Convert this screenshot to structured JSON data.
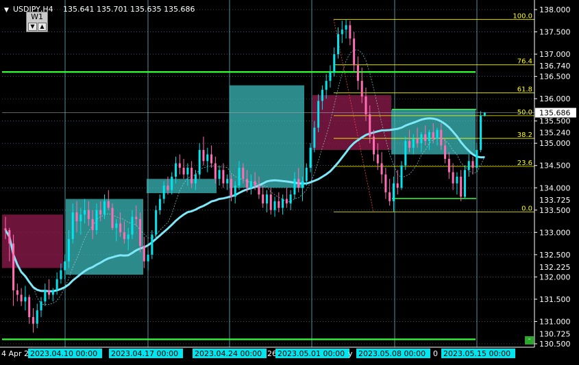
{
  "header": {
    "symbol_label": "USDJPY,H4",
    "ohlc": "135.641 135.701 135.635 135.686",
    "menu_arrow": "▼"
  },
  "timeframe_panel": {
    "label": "W1",
    "down_btn": "▼",
    "up_btn": "▲"
  },
  "colors": {
    "background": "#000000",
    "grid": "#7ad7ea",
    "bull_candle": "#00e5ee",
    "bear_candle": "#ff6eb4",
    "zone_bull": "#3fbfbf",
    "zone_bear": "#8b1a4a",
    "ma_slow": "#7ee8f8",
    "ma_fast": "#9fdfe0",
    "fibo": "#ffff00",
    "hline_green": "#33ff33",
    "axis_text": "#ffffff",
    "date_bg": "#00e5ee"
  },
  "chart_data": {
    "type": "candlestick",
    "symbol": "USDJPY",
    "timeframe": "H4",
    "ylim": [
      130.5,
      138.0
    ],
    "y_ticks": [
      "138.000",
      "137.500",
      "137.000",
      "136.500",
      "136.000",
      "135.500",
      "135.000",
      "134.500",
      "134.000",
      "133.500",
      "133.000",
      "132.500",
      "132.000",
      "131.500",
      "131.000",
      "130.500"
    ],
    "price_labels": [
      {
        "text": "136.740",
        "value": 136.74
      },
      {
        "text": "135.686",
        "value": 135.686,
        "current": true
      },
      {
        "text": "135.240",
        "value": 135.24
      },
      {
        "text": "133.725",
        "value": 133.725
      },
      {
        "text": "132.225",
        "value": 132.225
      },
      {
        "text": "130.725",
        "value": 130.725
      }
    ],
    "x_labels": [
      {
        "text": "4 Apr 2",
        "partial": true
      },
      {
        "text": "2023.04.10 00:00",
        "highlight": true
      },
      {
        "text": "2023.04.17 00:00",
        "highlight": true
      },
      {
        "text": "2023.04.24 00:00",
        "highlight": true
      },
      {
        "text": "26",
        "partial": true
      },
      {
        "text": "2023.05.01 00:00",
        "highlight": true
      },
      {
        "text": "y",
        "partial": true
      },
      {
        "text": "2023.05.08 00:00",
        "highlight": true
      },
      {
        "text": "0",
        "partial": true
      },
      {
        "text": "2023.05.15 00:00",
        "highlight": true
      }
    ],
    "fibonacci": {
      "high": 137.78,
      "low": 133.46,
      "levels": [
        {
          "label": "100.0",
          "value": 137.78
        },
        {
          "label": "76.4",
          "value": 136.76
        },
        {
          "label": "61.8",
          "value": 136.13
        },
        {
          "label": "50.0",
          "value": 135.62
        },
        {
          "label": "38.2",
          "value": 135.11
        },
        {
          "label": "23.6",
          "value": 134.48
        },
        {
          "label": "0.0",
          "value": 133.46
        }
      ]
    },
    "horizontal_lines": [
      {
        "value": 136.6,
        "color": "green",
        "span": "full"
      },
      {
        "value": 130.6,
        "color": "green",
        "span": "full"
      },
      {
        "value": 135.76,
        "color": "green",
        "span": "segment"
      },
      {
        "value": 133.76,
        "color": "green",
        "span": "segment"
      }
    ],
    "zones": [
      {
        "kind": "bear",
        "top": 133.4,
        "bottom": 132.2
      },
      {
        "kind": "bull",
        "top": 133.75,
        "bottom": 132.05
      },
      {
        "kind": "bull",
        "top": 134.2,
        "bottom": 133.88
      },
      {
        "kind": "bull",
        "top": 136.3,
        "bottom": 134.0
      },
      {
        "kind": "bear",
        "top": 136.08,
        "bottom": 134.85
      },
      {
        "kind": "bull",
        "top": 135.75,
        "bottom": 134.75
      }
    ],
    "candles": [
      [
        133.09,
        133.35,
        132.85,
        133.05
      ],
      [
        133.05,
        133.1,
        132.35,
        132.75
      ],
      [
        132.75,
        132.95,
        131.35,
        131.7
      ],
      [
        131.7,
        131.85,
        131.45,
        131.6
      ],
      [
        131.6,
        131.75,
        131.35,
        131.45
      ],
      [
        131.45,
        131.8,
        131.25,
        131.55
      ],
      [
        131.55,
        131.6,
        130.95,
        131.1
      ],
      [
        131.1,
        131.3,
        130.75,
        130.95
      ],
      [
        130.95,
        131.4,
        130.85,
        131.25
      ],
      [
        131.25,
        131.55,
        131.1,
        131.45
      ],
      [
        131.45,
        131.85,
        131.35,
        131.7
      ],
      [
        131.7,
        131.95,
        131.5,
        131.6
      ],
      [
        131.6,
        131.75,
        131.45,
        131.7
      ],
      [
        131.7,
        132.1,
        131.6,
        131.95
      ],
      [
        131.95,
        132.3,
        131.85,
        132.15
      ],
      [
        132.15,
        132.5,
        131.95,
        132.35
      ],
      [
        132.35,
        133.05,
        132.2,
        132.85
      ],
      [
        132.85,
        133.65,
        132.75,
        133.45
      ],
      [
        133.45,
        133.7,
        133.0,
        133.25
      ],
      [
        133.25,
        133.55,
        132.95,
        133.4
      ],
      [
        133.4,
        133.75,
        133.2,
        133.5
      ],
      [
        133.5,
        133.7,
        133.15,
        133.3
      ],
      [
        133.3,
        133.5,
        132.85,
        133.05
      ],
      [
        133.05,
        133.65,
        132.95,
        133.5
      ],
      [
        133.5,
        133.7,
        133.25,
        133.4
      ],
      [
        133.4,
        133.85,
        133.3,
        133.7
      ],
      [
        133.7,
        133.95,
        133.5,
        133.55
      ],
      [
        133.55,
        133.65,
        133.05,
        133.1
      ],
      [
        133.1,
        133.3,
        132.8,
        133.2
      ],
      [
        133.2,
        133.45,
        132.9,
        133.0
      ],
      [
        133.0,
        133.25,
        132.75,
        132.85
      ],
      [
        132.85,
        133.1,
        132.6,
        132.95
      ],
      [
        132.95,
        133.5,
        132.85,
        133.35
      ],
      [
        133.35,
        133.6,
        133.15,
        133.3
      ],
      [
        133.3,
        133.45,
        132.55,
        132.7
      ],
      [
        132.7,
        132.9,
        132.2,
        132.35
      ],
      [
        132.35,
        132.6,
        132.15,
        132.5
      ],
      [
        132.5,
        133.05,
        132.4,
        132.95
      ],
      [
        132.95,
        133.6,
        132.85,
        133.5
      ],
      [
        133.5,
        133.85,
        133.4,
        133.75
      ],
      [
        133.75,
        134.15,
        133.65,
        134.05
      ],
      [
        134.05,
        134.25,
        133.85,
        133.95
      ],
      [
        133.95,
        134.35,
        133.85,
        134.25
      ],
      [
        134.25,
        134.7,
        134.1,
        134.55
      ],
      [
        134.55,
        134.75,
        134.3,
        134.45
      ],
      [
        134.45,
        134.65,
        134.2,
        134.3
      ],
      [
        134.3,
        134.55,
        134.05,
        134.45
      ],
      [
        134.45,
        134.6,
        134.0,
        134.1
      ],
      [
        134.1,
        134.4,
        133.95,
        134.3
      ],
      [
        134.3,
        135.0,
        134.2,
        134.85
      ],
      [
        134.85,
        135.15,
        134.5,
        134.6
      ],
      [
        134.6,
        134.9,
        134.35,
        134.75
      ],
      [
        134.75,
        134.95,
        134.45,
        134.55
      ],
      [
        134.55,
        134.7,
        134.1,
        134.2
      ],
      [
        134.2,
        134.5,
        134.05,
        134.4
      ],
      [
        134.4,
        134.55,
        134.0,
        134.1
      ],
      [
        134.1,
        134.3,
        133.95,
        134.2
      ],
      [
        134.2,
        134.3,
        133.7,
        133.8
      ],
      [
        133.8,
        134.15,
        133.65,
        134.05
      ],
      [
        134.05,
        134.6,
        133.95,
        134.45
      ],
      [
        134.45,
        134.55,
        134.1,
        134.2
      ],
      [
        134.2,
        134.4,
        133.9,
        134.0
      ],
      [
        134.0,
        134.3,
        133.85,
        134.15
      ],
      [
        134.15,
        134.35,
        133.95,
        134.05
      ],
      [
        134.05,
        134.25,
        133.75,
        133.85
      ],
      [
        133.85,
        134.05,
        133.55,
        133.65
      ],
      [
        133.65,
        133.95,
        133.45,
        133.85
      ],
      [
        133.85,
        134.0,
        133.4,
        133.5
      ],
      [
        133.5,
        133.8,
        133.35,
        133.7
      ],
      [
        133.7,
        133.9,
        133.45,
        133.55
      ],
      [
        133.55,
        133.85,
        133.4,
        133.75
      ],
      [
        133.75,
        134.0,
        133.55,
        133.65
      ],
      [
        133.65,
        133.95,
        133.5,
        133.85
      ],
      [
        133.85,
        134.35,
        133.75,
        134.2
      ],
      [
        134.2,
        134.45,
        133.9,
        134.0
      ],
      [
        134.0,
        134.25,
        133.7,
        134.15
      ],
      [
        134.15,
        134.55,
        134.05,
        134.45
      ],
      [
        134.45,
        135.0,
        134.35,
        134.9
      ],
      [
        134.9,
        135.5,
        134.8,
        135.35
      ],
      [
        135.35,
        136.1,
        135.25,
        135.95
      ],
      [
        135.95,
        136.3,
        135.75,
        136.2
      ],
      [
        136.2,
        136.55,
        136.0,
        136.4
      ],
      [
        136.4,
        136.75,
        136.25,
        136.6
      ],
      [
        136.6,
        137.15,
        136.5,
        137.0
      ],
      [
        137.0,
        137.6,
        136.9,
        137.45
      ],
      [
        137.45,
        137.75,
        137.25,
        137.55
      ],
      [
        137.55,
        137.78,
        137.35,
        137.65
      ],
      [
        137.65,
        137.75,
        137.2,
        137.35
      ],
      [
        137.35,
        137.5,
        136.6,
        136.75
      ],
      [
        136.75,
        136.95,
        136.2,
        136.4
      ],
      [
        136.4,
        136.7,
        135.9,
        136.05
      ],
      [
        136.05,
        136.25,
        135.5,
        135.65
      ],
      [
        135.65,
        135.85,
        135.0,
        135.15
      ],
      [
        135.15,
        135.3,
        134.6,
        134.75
      ],
      [
        134.75,
        135.0,
        134.4,
        134.55
      ],
      [
        134.55,
        134.8,
        134.1,
        134.3
      ],
      [
        134.3,
        134.45,
        133.75,
        133.9
      ],
      [
        133.9,
        134.2,
        133.6,
        133.7
      ],
      [
        133.7,
        134.25,
        133.46,
        134.1
      ],
      [
        134.1,
        134.4,
        133.85,
        134.0
      ],
      [
        134.0,
        134.6,
        133.95,
        134.5
      ],
      [
        134.5,
        135.15,
        134.4,
        135.05
      ],
      [
        135.05,
        135.3,
        134.8,
        134.9
      ],
      [
        134.9,
        135.2,
        134.75,
        135.1
      ],
      [
        135.1,
        135.35,
        134.9,
        135.0
      ],
      [
        135.0,
        135.25,
        134.8,
        135.2
      ],
      [
        135.2,
        135.4,
        134.95,
        135.05
      ],
      [
        135.05,
        135.3,
        134.85,
        135.25
      ],
      [
        135.25,
        135.45,
        135.0,
        135.1
      ],
      [
        135.1,
        135.35,
        134.95,
        135.3
      ],
      [
        135.3,
        135.45,
        134.85,
        134.95
      ],
      [
        134.95,
        135.1,
        134.55,
        134.65
      ],
      [
        134.65,
        134.8,
        134.2,
        134.35
      ],
      [
        134.35,
        134.55,
        133.95,
        134.1
      ],
      [
        134.1,
        134.35,
        133.85,
        134.25
      ],
      [
        134.25,
        134.4,
        133.7,
        133.8
      ],
      [
        133.8,
        134.5,
        133.75,
        134.4
      ],
      [
        134.4,
        134.75,
        134.25,
        134.6
      ],
      [
        134.6,
        134.7,
        134.3,
        134.45
      ],
      [
        134.45,
        135.0,
        134.35,
        134.85
      ],
      [
        134.85,
        135.72,
        134.8,
        135.62
      ],
      [
        135.62,
        135.7,
        135.6,
        135.686
      ]
    ]
  }
}
